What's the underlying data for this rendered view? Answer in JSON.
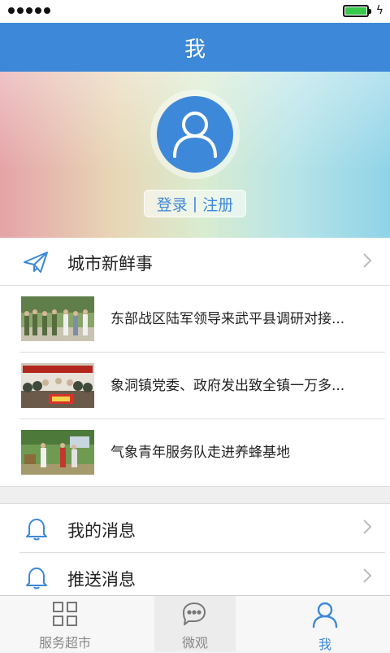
{
  "header": {
    "title": "我"
  },
  "profile": {
    "login_label": "登录",
    "separator": "|",
    "register_label": "注册"
  },
  "city_news": {
    "header_label": "城市新鲜事",
    "items": [
      {
        "title": "东部战区陆军领导来武平县调研对接..."
      },
      {
        "title": "象洞镇党委、政府发出致全镇一万多..."
      },
      {
        "title": "气象青年服务队走进养蜂基地"
      }
    ]
  },
  "menu": {
    "my_messages": "我的消息",
    "push_messages": "推送消息"
  },
  "tabbar": {
    "tabs": [
      {
        "label": "服务超市"
      },
      {
        "label": "微观"
      },
      {
        "label": "我"
      }
    ],
    "active_color": "#3d88d8"
  },
  "colors": {
    "accent": "#3d88d8",
    "battery": "#37c94a"
  }
}
